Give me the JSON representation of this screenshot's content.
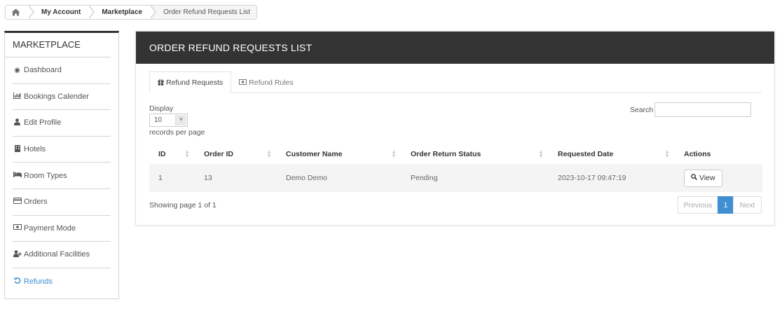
{
  "breadcrumb": {
    "home_icon": "home-icon",
    "items": [
      "My Account",
      "Marketplace"
    ],
    "current": "Order Refund Requests List"
  },
  "sidebar": {
    "title": "MARKETPLACE",
    "items": [
      {
        "label": "Dashboard",
        "icon": "dashboard-icon"
      },
      {
        "label": "Bookings Calender",
        "icon": "bar-chart-icon"
      },
      {
        "label": "Edit Profile",
        "icon": "user-icon"
      },
      {
        "label": "Hotels",
        "icon": "building-icon"
      },
      {
        "label": "Room Types",
        "icon": "bed-icon"
      },
      {
        "label": "Orders",
        "icon": "credit-card-icon"
      },
      {
        "label": "Payment Mode",
        "icon": "money-icon"
      },
      {
        "label": "Additional Facilities",
        "icon": "user-plus-icon"
      },
      {
        "label": "Refunds",
        "icon": "undo-icon"
      }
    ],
    "active_color": "#3f8fd2"
  },
  "panel": {
    "title": "ORDER REFUND REQUESTS LIST",
    "tabs": [
      {
        "label": "Refund Requests",
        "icon": "gift-icon",
        "active": true
      },
      {
        "label": "Refund Rules",
        "icon": "money-icon",
        "active": false
      }
    ],
    "display_label": "Display",
    "page_size": "10",
    "records_label": "records per page",
    "search_label": "Search",
    "search_value": "",
    "table": {
      "columns": [
        "ID",
        "Order ID",
        "Customer Name",
        "Order Return Status",
        "Requested Date",
        "Actions"
      ],
      "rows": [
        {
          "id": "1",
          "order_id": "13",
          "customer": "Demo Demo",
          "status": "Pending",
          "date": "2023-10-17 09:47:19",
          "action": "View"
        }
      ]
    },
    "showing": "Showing page 1 of 1",
    "pagination": {
      "prev": "Previous",
      "page": "1",
      "next": "Next"
    }
  },
  "colors": {
    "header_bg": "#333333",
    "accent": "#3f8fd2"
  }
}
